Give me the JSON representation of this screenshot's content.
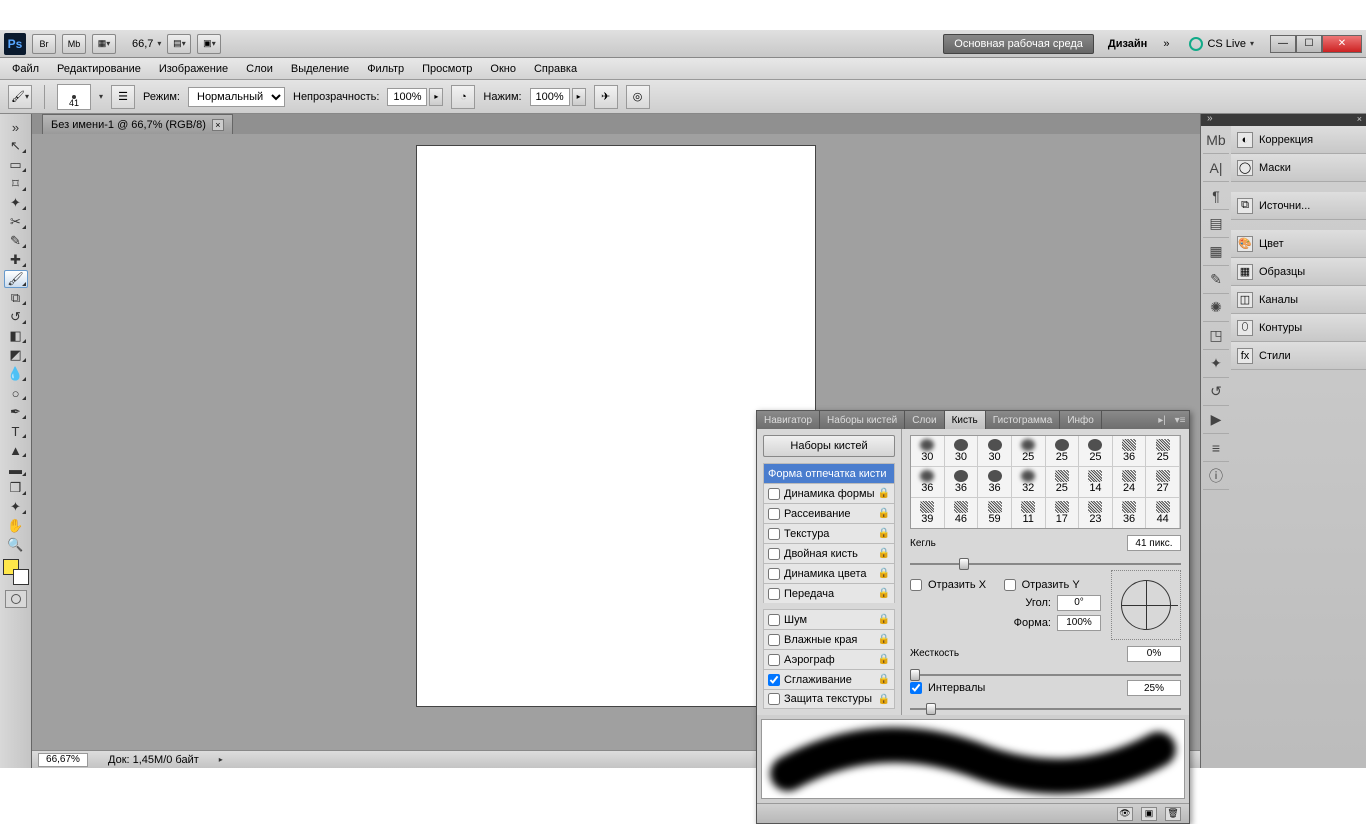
{
  "titlebar": {
    "zoom": "66,7",
    "workspace": "Основная рабочая среда",
    "design": "Дизайн",
    "cslive": "CS Live"
  },
  "menubar": [
    "Файл",
    "Редактирование",
    "Изображение",
    "Слои",
    "Выделение",
    "Фильтр",
    "Просмотр",
    "Окно",
    "Справка"
  ],
  "optbar": {
    "brush_size": "41",
    "mode_label": "Режим:",
    "mode_value": "Нормальный",
    "opacity_label": "Непрозрачность:",
    "opacity_value": "100%",
    "flow_label": "Нажим:",
    "flow_value": "100%"
  },
  "document": {
    "tab": "Без имени-1 @ 66,7% (RGB/8)"
  },
  "statusbar": {
    "zoom": "66,67%",
    "docinfo": "Док: 1,45M/0 байт"
  },
  "rdock": {
    "items": [
      {
        "label": "Коррекция"
      },
      {
        "label": "Маски"
      },
      {
        "label": "Источни..."
      },
      {
        "label": "Цвет"
      },
      {
        "label": "Образцы"
      },
      {
        "label": "Каналы"
      },
      {
        "label": "Контуры"
      },
      {
        "label": "Стили"
      }
    ]
  },
  "brushpanel": {
    "tabs": [
      "Навигатор",
      "Наборы кистей",
      "Слои",
      "Кисть",
      "Гистограмма",
      "Инфо"
    ],
    "active_tab": "Кисть",
    "sets_button": "Наборы кистей",
    "options": [
      {
        "label": "Форма отпечатка кисти",
        "checked": false,
        "selected": true,
        "nocb": true
      },
      {
        "label": "Динамика формы",
        "checked": false
      },
      {
        "label": "Рассеивание",
        "checked": false
      },
      {
        "label": "Текстура",
        "checked": false
      },
      {
        "label": "Двойная кисть",
        "checked": false
      },
      {
        "label": "Динамика цвета",
        "checked": false
      },
      {
        "label": "Передача",
        "checked": false
      }
    ],
    "options2": [
      {
        "label": "Шум",
        "checked": false
      },
      {
        "label": "Влажные края",
        "checked": false
      },
      {
        "label": "Аэрограф",
        "checked": false
      },
      {
        "label": "Сглаживание",
        "checked": true
      },
      {
        "label": "Защита текстуры",
        "checked": false
      }
    ],
    "brush_sizes_r1": [
      "30",
      "30",
      "30",
      "25",
      "25",
      "25",
      "36",
      "25"
    ],
    "brush_sizes_r2": [
      "36",
      "36",
      "36",
      "32",
      "25",
      "14",
      "24",
      "27"
    ],
    "brush_sizes_r3": [
      "39",
      "46",
      "59",
      "11",
      "17",
      "23",
      "36",
      "44"
    ],
    "size_label": "Кегль",
    "size_value": "41 пикс.",
    "flipx": "Отразить X",
    "flipy": "Отразить Y",
    "angle_label": "Угол:",
    "angle_value": "0°",
    "round_label": "Форма:",
    "round_value": "100%",
    "hardness_label": "Жесткость",
    "hardness_value": "0%",
    "spacing_label": "Интервалы",
    "spacing_value": "25%"
  }
}
